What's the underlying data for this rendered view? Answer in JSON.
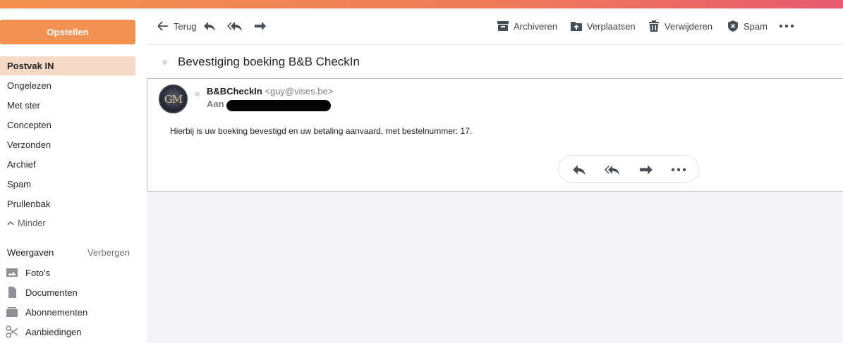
{
  "sidebar": {
    "compose_label": "Opstellen",
    "folders": [
      {
        "label": "Postvak IN"
      },
      {
        "label": "Ongelezen"
      },
      {
        "label": "Met ster"
      },
      {
        "label": "Concepten"
      },
      {
        "label": "Verzonden"
      },
      {
        "label": "Archief"
      },
      {
        "label": "Spam"
      },
      {
        "label": "Prullenbak"
      }
    ],
    "less_label": "Minder",
    "views_title": "Weergaven",
    "views_hide": "Verbergen",
    "views": [
      {
        "label": "Foto's",
        "icon": "image-icon"
      },
      {
        "label": "Documenten",
        "icon": "document-icon"
      },
      {
        "label": "Abonnementen",
        "icon": "subscriptions-icon"
      },
      {
        "label": "Aanbiedingen",
        "icon": "scissors-icon"
      }
    ]
  },
  "toolbar": {
    "back_label": "Terug",
    "archive_label": "Archiveren",
    "move_label": "Verplaatsen",
    "delete_label": "Verwijderen",
    "spam_label": "Spam"
  },
  "message": {
    "subject": "Bevestiging boeking B&B CheckIn",
    "sender_name": "B&BCheckIn",
    "sender_email": "<guy@vises.be>",
    "to_label": "Aan",
    "avatar_text": "GM",
    "body": "Hierbij is uw boeking bevestigd en uw betaling aanvaard, met bestelnummer: 17."
  },
  "colors": {
    "accent": "#f39153",
    "active_folder_bg": "#f6d8c6"
  }
}
